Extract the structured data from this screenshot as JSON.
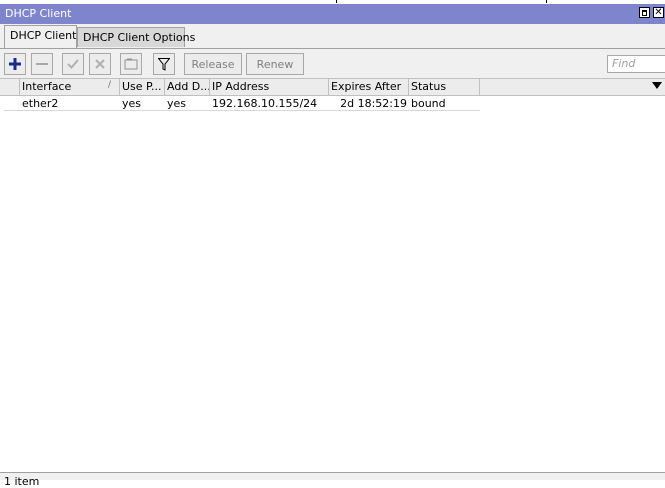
{
  "window": {
    "title": "DHCP Client"
  },
  "tabs": [
    {
      "label": "DHCP Client",
      "active": true
    },
    {
      "label": "DHCP Client Options",
      "active": false
    }
  ],
  "toolbar": {
    "release_label": "Release",
    "renew_label": "Renew",
    "find_placeholder": "Find",
    "icons": [
      "add-icon",
      "remove-icon",
      "enable-icon",
      "disable-icon",
      "comment-icon",
      "filter-icon"
    ]
  },
  "table": {
    "columns": [
      "Interface",
      "Use P...",
      "Add D...",
      "IP Address",
      "Expires After",
      "Status"
    ],
    "rows": [
      {
        "interface": "ether2",
        "use_peer_dns": "yes",
        "add_default_route": "yes",
        "ip_address": "192.168.10.155/24",
        "expires_after": "2d 18:52:19",
        "status": "bound"
      }
    ]
  },
  "statusbar": {
    "text": "1 item"
  },
  "colors": {
    "titlebar": "#7f85cc",
    "add_icon": "#1a2a8a"
  }
}
